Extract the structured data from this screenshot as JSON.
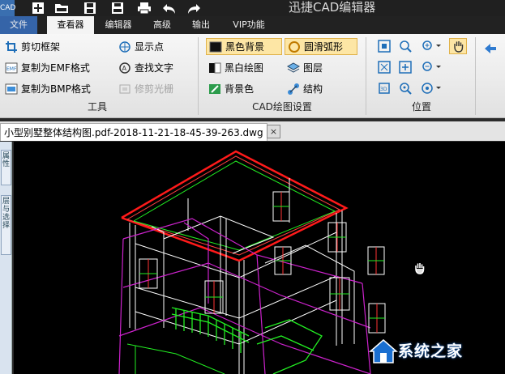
{
  "app": {
    "title": "迅捷CAD编辑器",
    "logo_text": "CAD"
  },
  "quick_access": [
    "new-icon",
    "open-icon",
    "save-icon",
    "save-pdf-icon",
    "print-icon",
    "undo-icon",
    "redo-icon"
  ],
  "tabs": [
    {
      "label": "文件"
    },
    {
      "label": "查看器",
      "active": true
    },
    {
      "label": "编辑器"
    },
    {
      "label": "高级"
    },
    {
      "label": "输出"
    },
    {
      "label": "VIP功能"
    }
  ],
  "ribbon": {
    "tools": {
      "group_label": "工具",
      "items": [
        {
          "label": "剪切框架",
          "icon": "crop-frame-icon"
        },
        {
          "label": "显示点",
          "icon": "show-points-icon"
        },
        {
          "label": "复制为EMF格式",
          "icon": "emf-icon"
        },
        {
          "label": "查找文字",
          "icon": "find-text-icon"
        },
        {
          "label": "复制为BMP格式",
          "icon": "bmp-icon"
        },
        {
          "label": "修剪光栅",
          "icon": "trim-raster-icon",
          "disabled": true
        }
      ]
    },
    "cad_settings": {
      "group_label": "CAD绘图设置",
      "items": [
        {
          "label": "黑色背景",
          "icon": "black-background-icon",
          "selected": true
        },
        {
          "label": "圆滑弧形",
          "icon": "smooth-arc-icon",
          "selected": true
        },
        {
          "label": "黑白绘图",
          "icon": "black-white-icon"
        },
        {
          "label": "图层",
          "icon": "layers-icon"
        },
        {
          "label": "背景色",
          "icon": "background-color-icon"
        },
        {
          "label": "结构",
          "icon": "structure-icon"
        }
      ]
    },
    "position": {
      "group_label": "位置",
      "icons": [
        "fit-icon",
        "zoom-window-icon",
        "zoom-in-icon",
        "pan-hand-icon",
        "extents-icon",
        "zoom-rect-icon",
        "zoom-out-icon",
        "rotate-3d-icon",
        "zoom-realtime-icon",
        "orbit-icon"
      ]
    },
    "nav": {
      "icon": "back-arrow-icon"
    }
  },
  "document": {
    "tab_label": "小型别墅整体结构图.pdf-2018-11-21-18-45-39-263.dwg",
    "close_glyph": "×"
  },
  "side_panel": {
    "buttons": [
      "属性",
      "层与选择"
    ]
  },
  "colors": {
    "file_tab": "#3564a8",
    "canvas_background": "#000000",
    "highlight": "#fde6a5",
    "cad_red": "#ff1a1a",
    "cad_white": "#ffffff",
    "cad_magenta": "#cc22cc",
    "cad_green": "#22ee22"
  },
  "watermark": {
    "text": "系统之家"
  }
}
